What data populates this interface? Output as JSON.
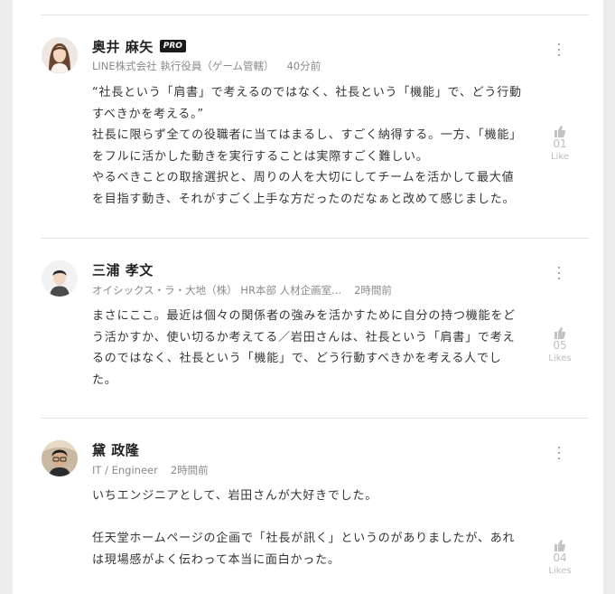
{
  "comments": [
    {
      "name": "奥井 麻矢",
      "badge": "PRO",
      "affiliation": "LINE株式会社 執行役員（ゲーム管轄）",
      "time": "40分前",
      "body": [
        "“社長という「肩書」で考えるのではなく、社長という「機能」で、どう行動すべきかを考える。”",
        "社長に限らず全ての役職者に当てはまるし、すごく納得する。一方、「機能」をフルに活かした動きを実行することは実際すごく難しい。",
        "やるべきことの取捨選択と、周りの人を大切にしてチームを活かして最大値を目指す動き、それがすごく上手な方だったのだなぁと改めて感じました。"
      ],
      "like_count": "01",
      "like_label": "Like",
      "avatar_icon": "avatar-woman-long-hair"
    },
    {
      "name": "三浦 孝文",
      "affiliation": "オイシックス・ラ・大地（株） HR本部 人材企画室...",
      "time": "2時間前",
      "body": [
        "まさにここ。最近は個々の関係者の強みを活かすために自分の持つ機能をどう活かすか、使い切るか考えてる／岩田さんは、社長という「肩書」で考えるのではなく、社長という「機能」で、どう行動すべきかを考える人でした。"
      ],
      "like_count": "05",
      "like_label": "Likes",
      "avatar_icon": "avatar-man-short-hair"
    },
    {
      "name": "黛 政隆",
      "affiliation": "IT / Engineer",
      "time": "2時間前",
      "body": [
        "いちエンジニアとして、岩田さんが大好きでした。",
        "",
        "任天堂ホームページの企画で「社長が訊く」というのがありましたが、あれは現場感がよく伝わって本当に面白かった。"
      ],
      "like_count": "04",
      "like_label": "Likes",
      "avatar_icon": "avatar-man-glasses"
    }
  ],
  "icons": {
    "more": "vertical-ellipsis-icon",
    "like": "thumbs-up-icon"
  },
  "colors": {
    "name": "#222222",
    "meta": "#8a8a8a",
    "body": "#333333",
    "like": "#bdbdbd",
    "badge_bg": "#1a1a1a"
  }
}
